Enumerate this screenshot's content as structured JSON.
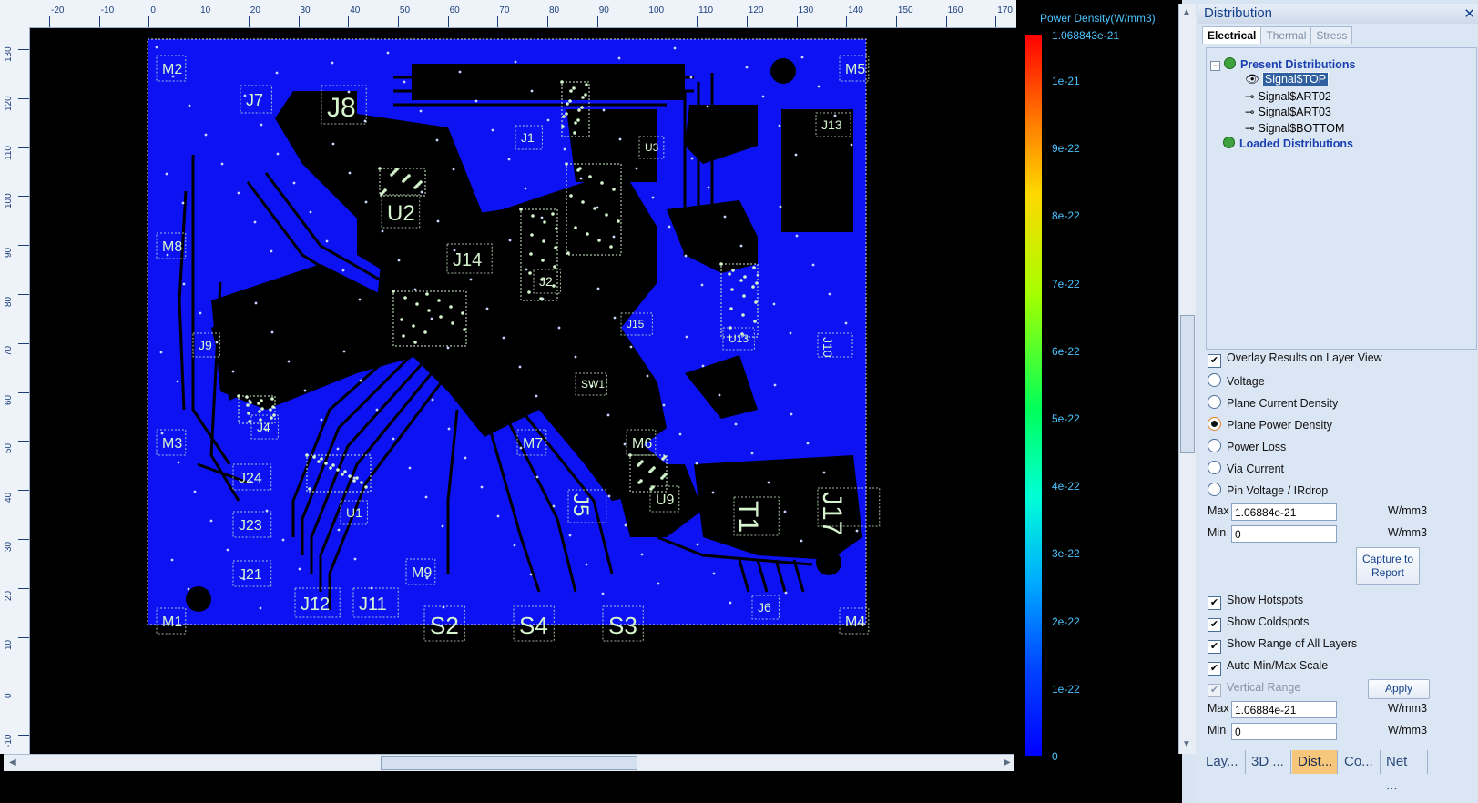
{
  "legend": {
    "title": "Power Density(W/mm3)",
    "ticks": [
      "1.068843e-21",
      "1e-21",
      "9e-22",
      "8e-22",
      "7e-22",
      "6e-22",
      "5e-22",
      "4e-22",
      "3e-22",
      "2e-22",
      "1e-22",
      "0"
    ]
  },
  "rulers": {
    "horizontal": [
      "-20",
      "-10",
      "0",
      "10",
      "20",
      "30",
      "40",
      "50",
      "60",
      "70",
      "80",
      "90",
      "100",
      "110",
      "120",
      "130",
      "140",
      "150",
      "160",
      "170"
    ],
    "vertical": [
      "130",
      "120",
      "110",
      "100",
      "90",
      "80",
      "70",
      "60",
      "50",
      "40",
      "30",
      "20",
      "10",
      "0",
      "-10"
    ]
  },
  "board": {
    "labels": [
      "J8",
      "J7",
      "U2",
      "J14",
      "J1",
      "J13",
      "M2",
      "M5",
      "M8",
      "M3",
      "M1",
      "M4",
      "M7",
      "M6",
      "M9",
      "U13",
      "SW1",
      "J10",
      "J24",
      "J23",
      "J21",
      "J12",
      "J11",
      "S2",
      "S4",
      "S3",
      "J6",
      "J5",
      "U9",
      "T1",
      "J17",
      "J9",
      "J4",
      "U1",
      "U3",
      "J2",
      "J15"
    ]
  },
  "panel": {
    "title": "Distribution",
    "close": "✕",
    "tabs": [
      "Electrical",
      "Thermal",
      "Stress"
    ],
    "tree": {
      "present": "Present Distributions",
      "items": [
        "Signal$TOP",
        "Signal$ART02",
        "Signal$ART03",
        "Signal$BOTTOM"
      ],
      "loaded": "Loaded Distributions"
    },
    "overlay": "Overlay Results on Layer View",
    "options": [
      "Voltage",
      "Plane Current Density",
      "Plane Power Density",
      "Power Loss",
      "Via Current",
      "Pin Voltage / IRdrop"
    ],
    "selected_option": "Plane Power Density",
    "max_label": "Max",
    "min_label": "Min",
    "max_value": "1.06884e-21",
    "min_value": "0",
    "unit": "W/mm3",
    "capture_button": "Capture to Report",
    "show_hotspots": "Show Hotspots",
    "show_coldspots": "Show Coldspots",
    "show_range": "Show Range of All Layers",
    "auto_minmax": "Auto Min/Max Scale",
    "vertical_range": "Vertical Range",
    "apply_button": "Apply",
    "vr_max_value": "1.06884e-21",
    "vr_min_value": "0",
    "bottom_tabs": [
      "Lay...",
      "3D ...",
      "Dist...",
      "Co...",
      "Net ..."
    ]
  },
  "colors": {
    "board": "#0c12f2",
    "copper_dark": "#000000",
    "silk": "#d6f5cf",
    "legend_text": "#4cc5ff"
  }
}
